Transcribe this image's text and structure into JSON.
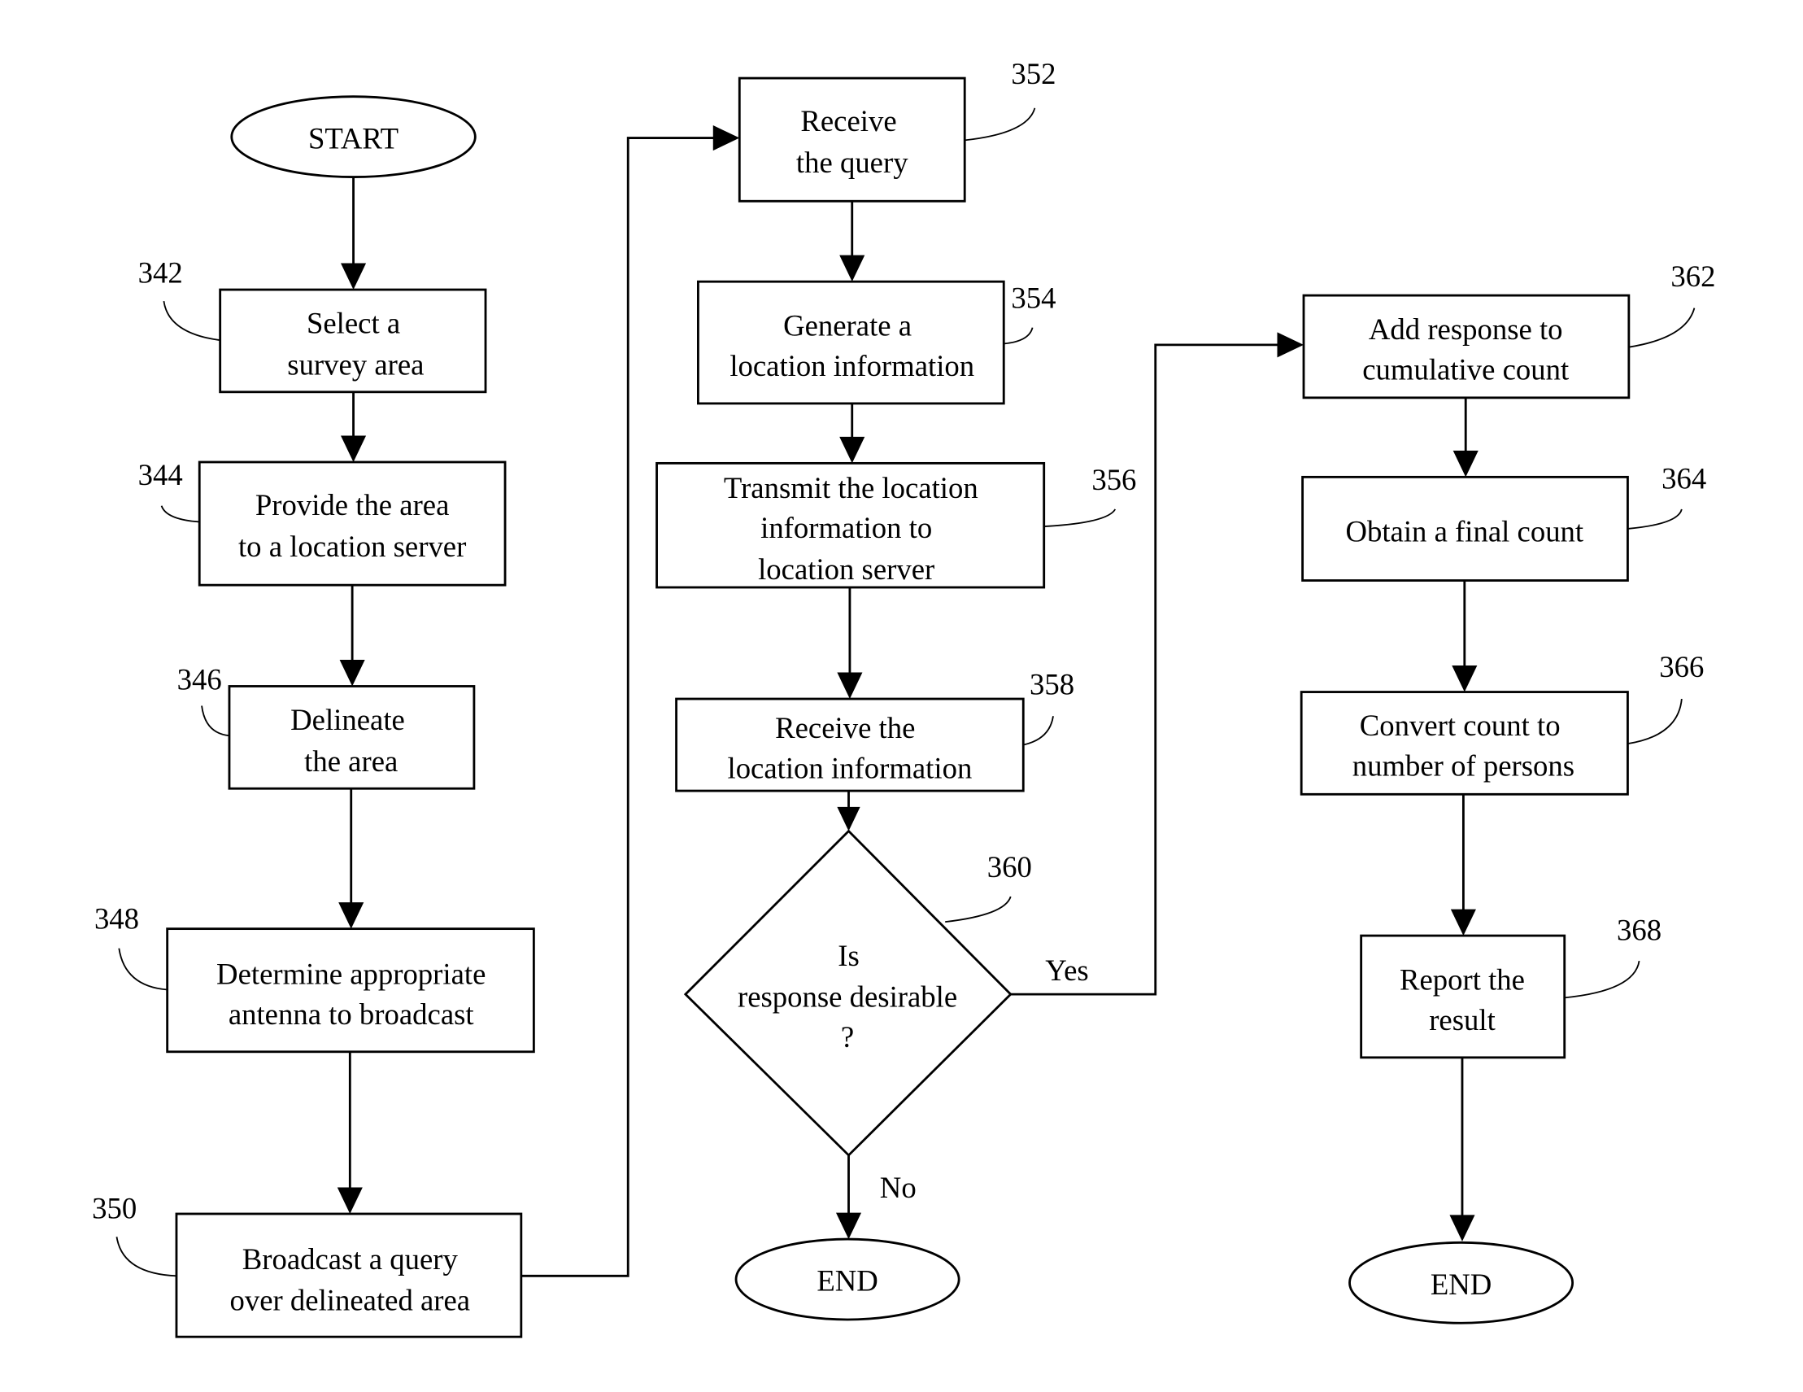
{
  "diagram": {
    "type": "flowchart",
    "nodes": {
      "start": {
        "shape": "terminal",
        "text": [
          "START"
        ]
      },
      "n342": {
        "ref": "342",
        "shape": "process",
        "text": [
          "Select a",
          "survey area"
        ]
      },
      "n344": {
        "ref": "344",
        "shape": "process",
        "text": [
          "Provide the area",
          "to a location server"
        ]
      },
      "n346": {
        "ref": "346",
        "shape": "process",
        "text": [
          "Delineate",
          "the area"
        ]
      },
      "n348": {
        "ref": "348",
        "shape": "process",
        "text": [
          "Determine appropriate",
          "antenna to broadcast"
        ]
      },
      "n350": {
        "ref": "350",
        "shape": "process",
        "text": [
          "Broadcast a query",
          "over delineated area"
        ]
      },
      "n352": {
        "ref": "352",
        "shape": "process",
        "text": [
          "Receive",
          "the query"
        ]
      },
      "n354": {
        "ref": "354",
        "shape": "process",
        "text": [
          "Generate a",
          "location information"
        ]
      },
      "n356": {
        "ref": "356",
        "shape": "process",
        "text": [
          "Transmit the location",
          "information to",
          "location server"
        ]
      },
      "n358": {
        "ref": "358",
        "shape": "process",
        "text": [
          "Receive the",
          "location information"
        ]
      },
      "n360": {
        "ref": "360",
        "shape": "decision",
        "text": [
          "Is",
          "response desirable",
          "?"
        ]
      },
      "n362": {
        "ref": "362",
        "shape": "process",
        "text": [
          "Add response to",
          "cumulative count"
        ]
      },
      "n364": {
        "ref": "364",
        "shape": "process",
        "text": [
          "Obtain a final count"
        ]
      },
      "n366": {
        "ref": "366",
        "shape": "process",
        "text": [
          "Convert count to",
          "number of persons"
        ]
      },
      "n368": {
        "ref": "368",
        "shape": "process",
        "text": [
          "Report the",
          "result"
        ]
      },
      "end_no": {
        "shape": "terminal",
        "text": [
          "END"
        ]
      },
      "end_final": {
        "shape": "terminal",
        "text": [
          "END"
        ]
      }
    },
    "edges": [
      {
        "from": "start",
        "to": "n342"
      },
      {
        "from": "n342",
        "to": "n344"
      },
      {
        "from": "n344",
        "to": "n346"
      },
      {
        "from": "n346",
        "to": "n348"
      },
      {
        "from": "n348",
        "to": "n350"
      },
      {
        "from": "n350",
        "to": "n352"
      },
      {
        "from": "n352",
        "to": "n354"
      },
      {
        "from": "n354",
        "to": "n356"
      },
      {
        "from": "n356",
        "to": "n358"
      },
      {
        "from": "n358",
        "to": "n360"
      },
      {
        "from": "n360",
        "to": "n362",
        "label": "Yes"
      },
      {
        "from": "n360",
        "to": "end_no",
        "label": "No"
      },
      {
        "from": "n362",
        "to": "n364"
      },
      {
        "from": "n364",
        "to": "n366"
      },
      {
        "from": "n366",
        "to": "n368"
      },
      {
        "from": "n368",
        "to": "end_final"
      }
    ],
    "edge_labels": {
      "yes": "Yes",
      "no": "No"
    }
  }
}
